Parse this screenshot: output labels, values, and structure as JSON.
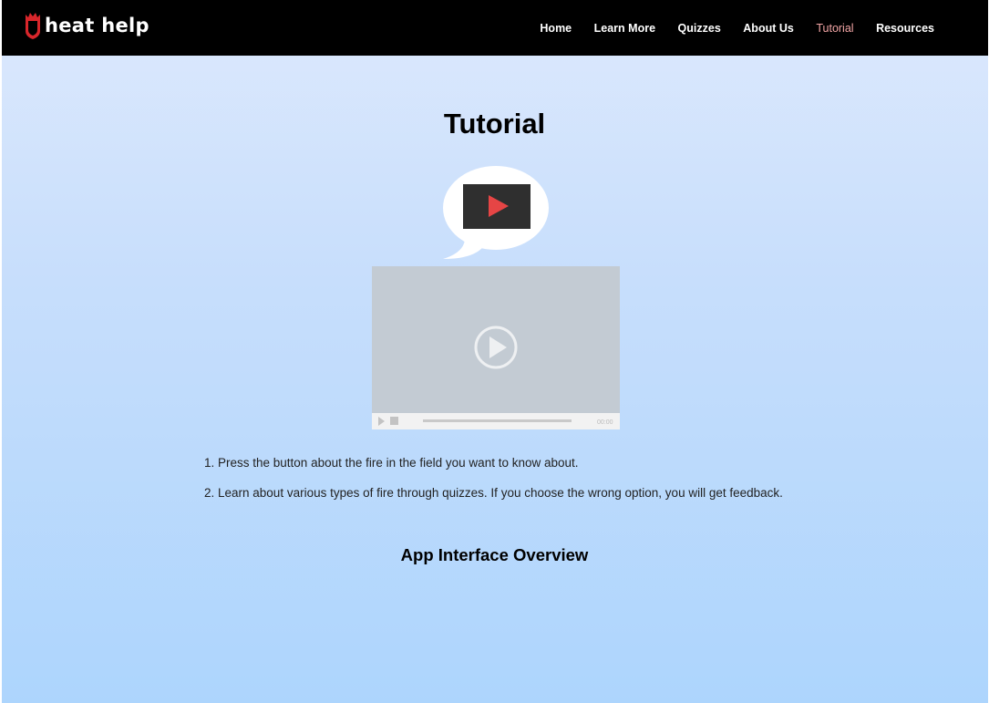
{
  "header": {
    "logo_text": "heat help",
    "nav": [
      {
        "label": "Home"
      },
      {
        "label": "Learn More"
      },
      {
        "label": "Quizzes"
      },
      {
        "label": "About Us"
      },
      {
        "label": "Tutorial",
        "active": true
      },
      {
        "label": "Resources"
      }
    ],
    "active_color": "#f2a5a5"
  },
  "main": {
    "title": "Tutorial",
    "video_player": {
      "time_label": "00:00",
      "icons": [
        "speech-bubble-play-icon",
        "play-circle-icon",
        "play-small-icon",
        "stop-icon"
      ]
    },
    "steps": [
      "1. Press the button about the fire in the field you want to know about.",
      "2. Learn about various types of fire through quizzes. If you choose the wrong option, you will get feedback."
    ],
    "section_heading": "App Interface Overview"
  }
}
